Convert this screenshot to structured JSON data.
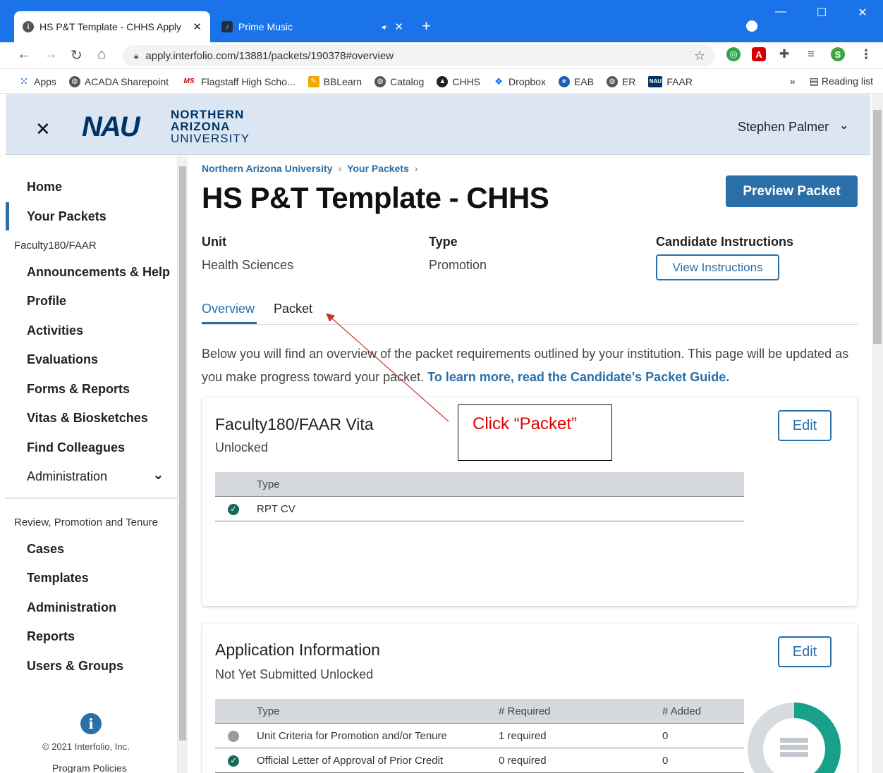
{
  "browser": {
    "tabs": [
      {
        "title": "HS P&T Template - CHHS Apply",
        "close": "✕"
      },
      {
        "title": "Prime Music",
        "audio": "◂ᐧ",
        "close": "✕"
      }
    ],
    "new_tab": "+",
    "window_controls": {
      "minimize": "—",
      "maximize": "☐",
      "close": "✕"
    },
    "url": "apply.interfolio.com/13881/packets/190378#overview",
    "profile_initial": "S",
    "bookmarks": [
      {
        "label": "Apps",
        "icon": "apps-grid-icon"
      },
      {
        "label": "ACADA Sharepoint",
        "icon": "globe-icon"
      },
      {
        "label": "Flagstaff High Scho...",
        "icon": "ms-icon"
      },
      {
        "label": "BBLearn",
        "icon": "pencil-icon"
      },
      {
        "label": "Catalog",
        "icon": "globe-icon"
      },
      {
        "label": "CHHS",
        "icon": "graduation-icon"
      },
      {
        "label": "Dropbox",
        "icon": "dropbox-icon"
      },
      {
        "label": "EAB",
        "icon": "eab-icon"
      },
      {
        "label": "ER",
        "icon": "globe-icon"
      },
      {
        "label": "FAAR",
        "icon": "nau-icon"
      }
    ],
    "bookmarks_overflow": "»",
    "reading_list": "Reading list",
    "ms_badge": "MS",
    "nau_badge": "NAU"
  },
  "header": {
    "close": "✕",
    "logo_mark": "NAU",
    "logo_line1": "NORTHERN",
    "logo_line2": "ARIZONA",
    "logo_line3": "UNIVERSITY",
    "user_name": "Stephen Palmer"
  },
  "sidebar": {
    "home": "Home",
    "your_packets": "Your Packets",
    "section_faculty": "Faculty180/FAAR",
    "announcements": "Announcements & Help",
    "profile": "Profile",
    "activities": "Activities",
    "evaluations": "Evaluations",
    "forms_reports": "Forms & Reports",
    "vitas": "Vitas & Biosketches",
    "find_colleagues": "Find Colleagues",
    "administration1": "Administration",
    "section_rpt": "Review, Promotion and Tenure",
    "cases": "Cases",
    "templates": "Templates",
    "administration2": "Administration",
    "reports": "Reports",
    "users_groups": "Users & Groups",
    "copyright": "© 2021 Interfolio, Inc.",
    "program_policies": "Program Policies"
  },
  "main": {
    "breadcrumb": [
      "Northern Arizona University",
      "Your Packets"
    ],
    "breadcrumb_sep": "›",
    "title": "HS P&T Template - CHHS",
    "preview_button": "Preview Packet",
    "unit_label": "Unit",
    "unit_value": "Health Sciences",
    "type_label": "Type",
    "type_value": "Promotion",
    "instructions_label": "Candidate Instructions",
    "view_instructions": "View Instructions",
    "tabs": [
      "Overview",
      "Packet"
    ],
    "intro_text": "Below you will find an overview of the packet requirements outlined by your institution. This page will be updated as you make progress toward your packet. ",
    "intro_link": "To learn more, read the Candidate's Packet Guide."
  },
  "card_vita": {
    "title": "Faculty180/FAAR Vita",
    "status": "Unlocked",
    "edit": "Edit",
    "col_type": "Type",
    "rows": [
      "RPT CV"
    ]
  },
  "card_app": {
    "title": "Application Information",
    "status": "Not Yet Submitted Unlocked",
    "edit": "Edit",
    "col_type": "Type",
    "col_required": "# Required",
    "col_added": "# Added",
    "rows": [
      {
        "type": "Unit Criteria for Promotion and/or Tenure",
        "required": "1 required",
        "added": "0",
        "status": "pending"
      },
      {
        "type": "Official Letter of Approval of Prior Credit",
        "required": "0 required",
        "added": "0",
        "status": "complete"
      }
    ],
    "progress_fraction": 0.5
  },
  "annotation": {
    "callout": "Click “Packet”",
    "color": "#e00000"
  },
  "colors": {
    "chrome_blue": "#1a73e8",
    "brand_blue": "#2a6fa8",
    "header_bg": "#dbe6f2",
    "teal": "#17a08a"
  }
}
